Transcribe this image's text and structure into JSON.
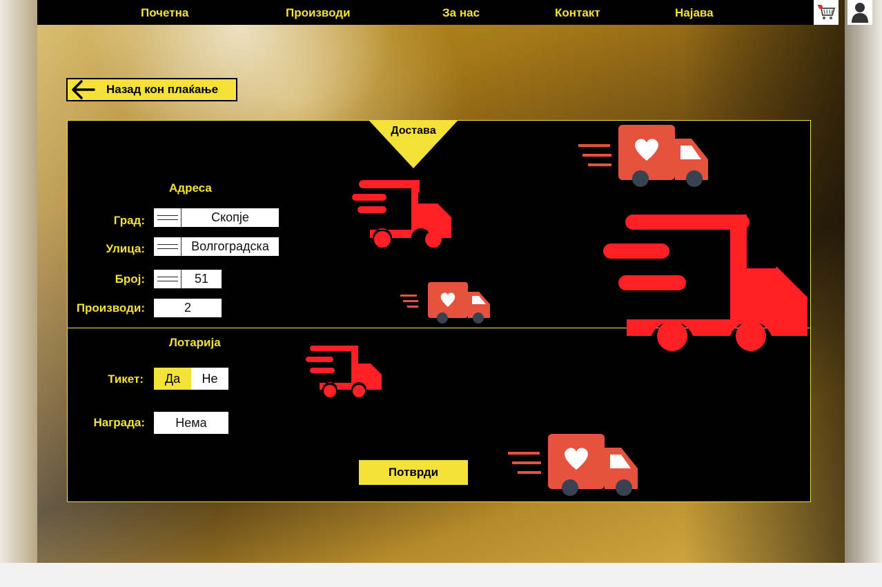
{
  "nav": {
    "links": [
      "Почетна",
      "Производи",
      "За нас",
      "Контакт",
      "Најава"
    ],
    "cart_icon": "shopping-cart-icon",
    "user_icon": "user-icon"
  },
  "back_button": {
    "label": "Назад кон плаќање",
    "icon": "arrow-left-icon"
  },
  "panel": {
    "tab_label": "Доставa",
    "address": {
      "title": "Адреса",
      "city_label": "Град:",
      "city_value": "Скопје",
      "street_label": "Улица:",
      "street_value": "Волгоградска",
      "number_label": "Број:",
      "number_value": "51",
      "products_label": "Производи:",
      "products_value": "2"
    },
    "lottery": {
      "title": "Лотарија",
      "ticket_label": "Тикет:",
      "yes_label": "Да",
      "no_label": "Не",
      "prize_label": "Награда:",
      "prize_value": "Нема"
    },
    "submit_label": "Потврди"
  },
  "colors": {
    "accent": "#f5e238",
    "truck_red": "#ff2026",
    "truck_body": "#e5533f",
    "panel_bg": "#000000"
  }
}
